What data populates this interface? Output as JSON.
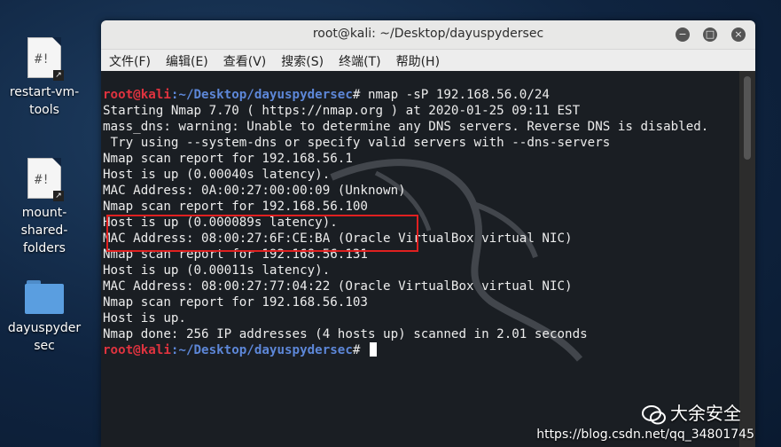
{
  "desktop": {
    "items": [
      {
        "label": "restart-vm-tools",
        "glyph": "#!",
        "icon": "script-file-icon"
      },
      {
        "label": "mount-shared-folders",
        "glyph": "#!",
        "icon": "script-file-icon"
      },
      {
        "label": "dayuspyder sec",
        "icon": "folder-icon"
      }
    ]
  },
  "window": {
    "title": "root@kali: ~/Desktop/dayuspydersec",
    "controls": {
      "minimize": "−",
      "maximize": "□",
      "close": "×"
    },
    "menu": [
      "文件(F)",
      "编辑(E)",
      "查看(V)",
      "搜索(S)",
      "终端(T)",
      "帮助(H)"
    ]
  },
  "terminal": {
    "prompt_user": "root@kali",
    "prompt_path": ":~/Desktop/dayuspydersec",
    "prompt_end": "# ",
    "command": "nmap -sP 192.168.56.0/24",
    "output": [
      "Starting Nmap 7.70 ( https://nmap.org ) at 2020-01-25 09:11 EST",
      "mass_dns: warning: Unable to determine any DNS servers. Reverse DNS is disabled.",
      " Try using --system-dns or specify valid servers with --dns-servers",
      "Nmap scan report for 192.168.56.1",
      "Host is up (0.00040s latency).",
      "MAC Address: 0A:00:27:00:00:09 (Unknown)",
      "Nmap scan report for 192.168.56.100",
      "Host is up (0.000089s latency).",
      "MAC Address: 08:00:27:6F:CE:BA (Oracle VirtualBox virtual NIC)",
      "Nmap scan report for 192.168.56.131",
      "Host is up (0.00011s latency).",
      "MAC Address: 08:00:27:77:04:22 (Oracle VirtualBox virtual NIC)",
      "Nmap scan report for 192.168.56.103",
      "Host is up.",
      "Nmap done: 256 IP addresses (4 hosts up) scanned in 2.01 seconds"
    ]
  },
  "overlay": {
    "brand": "大余安全",
    "watermark": "https://blog.csdn.net/qq_34801745"
  }
}
